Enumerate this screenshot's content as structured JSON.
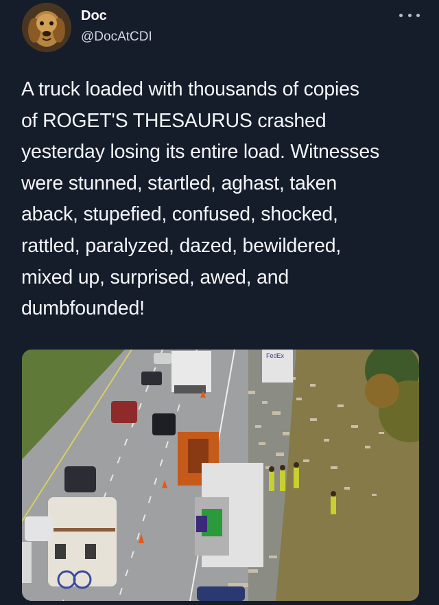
{
  "author": {
    "display_name": "Doc",
    "handle": "@DocAtCDI",
    "avatar_icon": "dog-avatar-icon"
  },
  "more_options_icon": "more-options-icon",
  "tweet": {
    "lines": [
      "A truck loaded with thousands of copies",
      "of ROGET'S THESAURUS crashed",
      "yesterday losing its entire load. Witnesses",
      "were stunned, startled, aghast, taken",
      "aback, stupefied, confused, shocked,",
      "rattled, paralyzed, dazed, bewildered,",
      "mixed up, surprised, awed, and",
      "dumbfounded!"
    ]
  },
  "media": {
    "fedex_label": "FedEx"
  },
  "colors": {
    "background": "#151d2b",
    "text": "#f4f6f9",
    "handle": "#d2d6dd"
  }
}
